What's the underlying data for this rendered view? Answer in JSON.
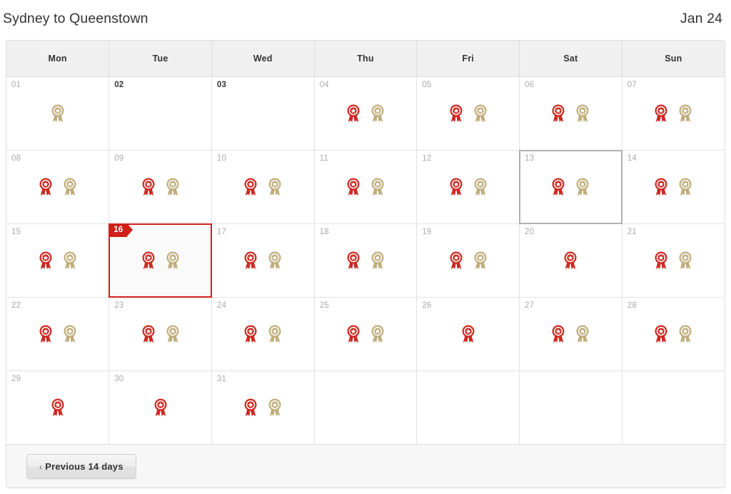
{
  "header": {
    "route_title": "Sydney to Queenstown",
    "month_label": "Jan 24"
  },
  "calendar": {
    "weekday_headers": [
      "Mon",
      "Tue",
      "Wed",
      "Thu",
      "Fri",
      "Sat",
      "Sun"
    ],
    "fare_colors": {
      "cheap": "#cd2a22",
      "standard": "#c0ad7b"
    },
    "selected_day": "16",
    "hovered_day": "13",
    "weeks": [
      [
        {
          "day": "01",
          "emphasis": "muted",
          "fares": [
            "standard"
          ],
          "state": "normal"
        },
        {
          "day": "02",
          "emphasis": "strong",
          "fares": [],
          "state": "normal"
        },
        {
          "day": "03",
          "emphasis": "strong",
          "fares": [],
          "state": "normal"
        },
        {
          "day": "04",
          "emphasis": "muted",
          "fares": [
            "cheap",
            "standard"
          ],
          "state": "normal"
        },
        {
          "day": "05",
          "emphasis": "muted",
          "fares": [
            "cheap",
            "standard"
          ],
          "state": "normal"
        },
        {
          "day": "06",
          "emphasis": "muted",
          "fares": [
            "cheap",
            "standard"
          ],
          "state": "normal"
        },
        {
          "day": "07",
          "emphasis": "muted",
          "fares": [
            "cheap",
            "standard"
          ],
          "state": "normal"
        }
      ],
      [
        {
          "day": "08",
          "emphasis": "muted",
          "fares": [
            "cheap",
            "standard"
          ],
          "state": "normal"
        },
        {
          "day": "09",
          "emphasis": "muted",
          "fares": [
            "cheap",
            "standard"
          ],
          "state": "normal"
        },
        {
          "day": "10",
          "emphasis": "muted",
          "fares": [
            "cheap",
            "standard"
          ],
          "state": "normal"
        },
        {
          "day": "11",
          "emphasis": "muted",
          "fares": [
            "cheap",
            "standard"
          ],
          "state": "normal"
        },
        {
          "day": "12",
          "emphasis": "muted",
          "fares": [
            "cheap",
            "standard"
          ],
          "state": "normal"
        },
        {
          "day": "13",
          "emphasis": "muted",
          "fares": [
            "cheap",
            "standard"
          ],
          "state": "hovered"
        },
        {
          "day": "14",
          "emphasis": "muted",
          "fares": [
            "cheap",
            "standard"
          ],
          "state": "normal"
        }
      ],
      [
        {
          "day": "15",
          "emphasis": "muted",
          "fares": [
            "cheap",
            "standard"
          ],
          "state": "normal"
        },
        {
          "day": "16",
          "emphasis": "muted",
          "fares": [
            "cheap",
            "standard"
          ],
          "state": "selected"
        },
        {
          "day": "17",
          "emphasis": "muted",
          "fares": [
            "cheap",
            "standard"
          ],
          "state": "normal"
        },
        {
          "day": "18",
          "emphasis": "muted",
          "fares": [
            "cheap",
            "standard"
          ],
          "state": "normal"
        },
        {
          "day": "19",
          "emphasis": "muted",
          "fares": [
            "cheap",
            "standard"
          ],
          "state": "normal"
        },
        {
          "day": "20",
          "emphasis": "muted",
          "fares": [
            "cheap"
          ],
          "state": "normal"
        },
        {
          "day": "21",
          "emphasis": "muted",
          "fares": [
            "cheap",
            "standard"
          ],
          "state": "normal"
        }
      ],
      [
        {
          "day": "22",
          "emphasis": "muted",
          "fares": [
            "cheap",
            "standard"
          ],
          "state": "normal"
        },
        {
          "day": "23",
          "emphasis": "muted",
          "fares": [
            "cheap",
            "standard"
          ],
          "state": "normal"
        },
        {
          "day": "24",
          "emphasis": "muted",
          "fares": [
            "cheap",
            "standard"
          ],
          "state": "normal"
        },
        {
          "day": "25",
          "emphasis": "muted",
          "fares": [
            "cheap",
            "standard"
          ],
          "state": "normal"
        },
        {
          "day": "26",
          "emphasis": "muted",
          "fares": [
            "cheap"
          ],
          "state": "normal"
        },
        {
          "day": "27",
          "emphasis": "muted",
          "fares": [
            "cheap",
            "standard"
          ],
          "state": "normal"
        },
        {
          "day": "28",
          "emphasis": "muted",
          "fares": [
            "cheap",
            "standard"
          ],
          "state": "normal"
        }
      ],
      [
        {
          "day": "29",
          "emphasis": "muted",
          "fares": [
            "cheap"
          ],
          "state": "normal"
        },
        {
          "day": "30",
          "emphasis": "muted",
          "fares": [
            "cheap"
          ],
          "state": "normal"
        },
        {
          "day": "31",
          "emphasis": "muted",
          "fares": [
            "cheap",
            "standard"
          ],
          "state": "normal"
        },
        {
          "day": "",
          "emphasis": "muted",
          "fares": [],
          "state": "empty"
        },
        {
          "day": "",
          "emphasis": "muted",
          "fares": [],
          "state": "empty"
        },
        {
          "day": "",
          "emphasis": "muted",
          "fares": [],
          "state": "empty"
        },
        {
          "day": "",
          "emphasis": "muted",
          "fares": [],
          "state": "empty"
        }
      ]
    ]
  },
  "footer": {
    "prev_chevron": "‹",
    "prev_label": "Previous 14 days"
  }
}
